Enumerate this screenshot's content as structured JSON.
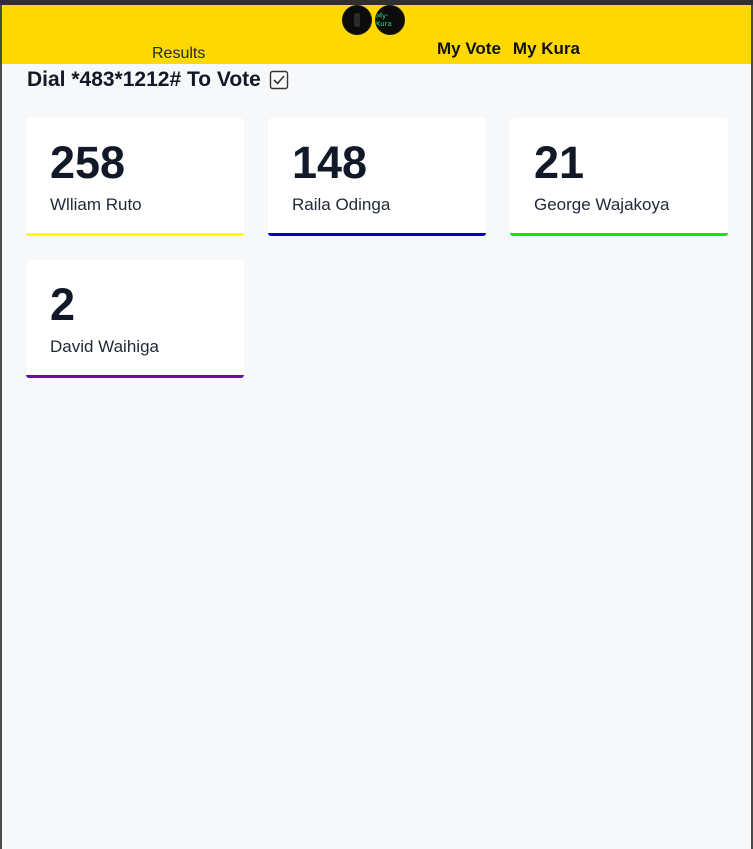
{
  "header": {
    "logo_one_text": "",
    "logo_two_text": "My-Kura",
    "results_label": "Results",
    "nav": [
      "My Vote",
      "My Kura"
    ]
  },
  "main": {
    "dial_text": "Dial *483*1212# To Vote"
  },
  "candidates": [
    {
      "votes": "258",
      "name": "Wlliam Ruto",
      "color": "#ffff00"
    },
    {
      "votes": "148",
      "name": "Raila Odinga",
      "color": "#0000c8"
    },
    {
      "votes": "21",
      "name": "George Wajakoya",
      "color": "#00ee00"
    },
    {
      "votes": "2",
      "name": "David Waihiga",
      "color": "#6a0dad"
    }
  ]
}
